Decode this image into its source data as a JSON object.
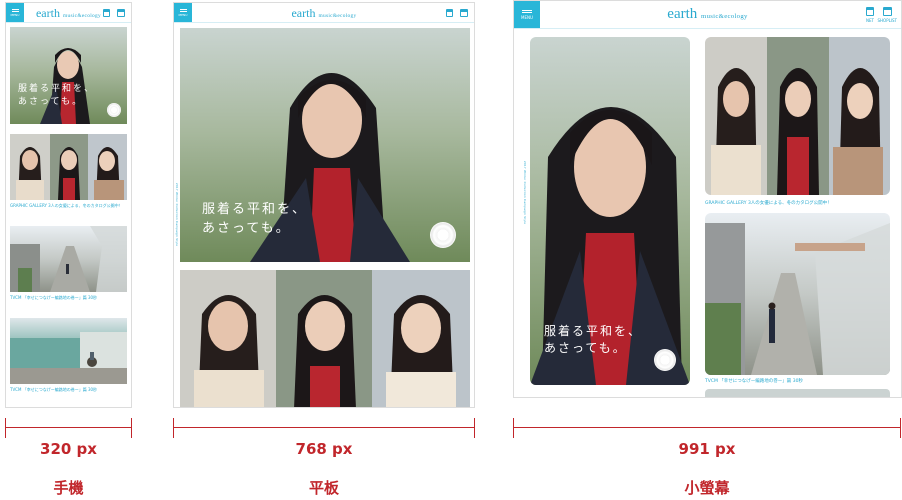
{
  "brand": {
    "logo": "earth",
    "logo_sub": "music&ecology"
  },
  "header": {
    "menu_label": "MENU",
    "net_label": "NET",
    "shoplist_label": "SHOPLIST"
  },
  "hero": {
    "copy": "服着る平和を、\nあさっても。"
  },
  "captions": {
    "gallery": "GRAPHIC GALLERY 3人の女優による、冬のカタログ公開中！",
    "tvcm1": "TVCM 「幸せにつなげー編路地の巻ー」篇 30秒",
    "tvcm2": "TVCM 「幸せにつなげー編路地の巻ー」篇 30秒",
    "vertical": "2017 Winter Collection Campaign Style"
  },
  "measures": [
    {
      "px": "320 px",
      "device": "手機"
    },
    {
      "px": "768 px",
      "device": "平板"
    },
    {
      "px": "991 px",
      "device": "小螢幕"
    }
  ],
  "colors": {
    "accent": "#29b6d8",
    "measure": "#c1262b"
  }
}
